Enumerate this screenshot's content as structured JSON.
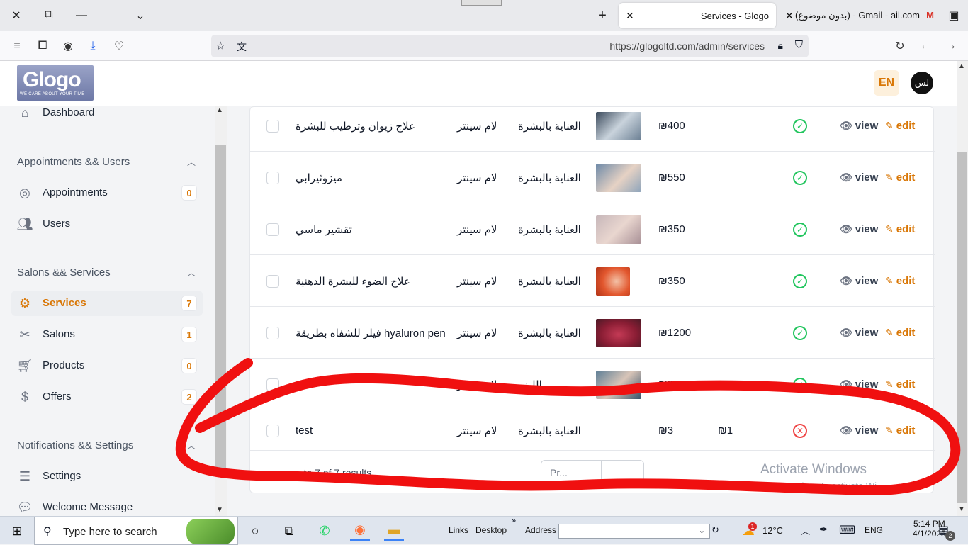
{
  "browser": {
    "tabs": [
      {
        "title": "Services - Glogo",
        "active": true
      },
      {
        "title": "(بدون موضوع) - Gmail - ail.com",
        "active": false
      }
    ],
    "url": "https://glogoltd.com/admin/services"
  },
  "header": {
    "logo_text": "Glogo",
    "logo_tagline": "WE CARE ABOUT YOUR TIME",
    "lang_button": "EN",
    "avatar_initials": "لس"
  },
  "sidebar": {
    "dashboard": {
      "label": "Dashboard"
    },
    "groups": [
      {
        "title": "Appointments && Users"
      },
      {
        "title": "Salons && Services"
      },
      {
        "title": "Notifications && Settings"
      }
    ],
    "items": [
      {
        "label": "Appointments",
        "badge": "0"
      },
      {
        "label": "Users"
      },
      {
        "label": "Services",
        "badge": "7"
      },
      {
        "label": "Salons",
        "badge": "1"
      },
      {
        "label": "Products",
        "badge": "0"
      },
      {
        "label": "Offers",
        "badge": "2"
      },
      {
        "label": "Settings"
      },
      {
        "label": "Welcome Message"
      }
    ]
  },
  "table": {
    "rows": [
      {
        "name": "علاج زيوان وترطيب للبشرة",
        "salon": "لام سينتر",
        "category": "العناية بالبشرة",
        "price": "₪400",
        "discount": "",
        "active": true
      },
      {
        "name": "ميزوثيرابي",
        "salon": "لام سينتر",
        "category": "العناية بالبشرة",
        "price": "₪550",
        "discount": "",
        "active": true
      },
      {
        "name": "تقشير ماسي",
        "salon": "لام سينتر",
        "category": "العناية بالبشرة",
        "price": "₪350",
        "discount": "",
        "active": true
      },
      {
        "name": "علاج الضوء للبشرة الدهنية",
        "salon": "لام سينتر",
        "category": "العناية بالبشرة",
        "price": "₪350",
        "discount": "",
        "active": true
      },
      {
        "name": "فيلر للشفاه بطريقة hyaluron pen",
        "salon": "لام سينتر",
        "category": "العناية بالبشرة",
        "price": "₪1200",
        "discount": "",
        "active": true
      },
      {
        "name": "",
        "salon": "لام سينتر",
        "category": "الليزر",
        "price": "₪350",
        "discount": "",
        "active": true
      },
      {
        "name": "test",
        "salon": "لام سينتر",
        "category": "العناية بالبشرة",
        "price": "₪3",
        "discount": "₪1",
        "active": false
      }
    ],
    "view_label": "view",
    "edit_label": "edit",
    "results_text": "... to 7 of 7 results",
    "pager_prev": "Pr..."
  },
  "watermark": {
    "line1": "Activate Windows",
    "line2": "Go to Settings to activate Wi..."
  },
  "taskbar": {
    "search_placeholder": "Type here to search",
    "links": "Links",
    "desktop": "Desktop",
    "address": "Address",
    "temperature": "12°C",
    "weather_badge": "1",
    "language": "ENG",
    "time": "5:14 PM",
    "date": "4/1/2025",
    "notifications": "2"
  }
}
